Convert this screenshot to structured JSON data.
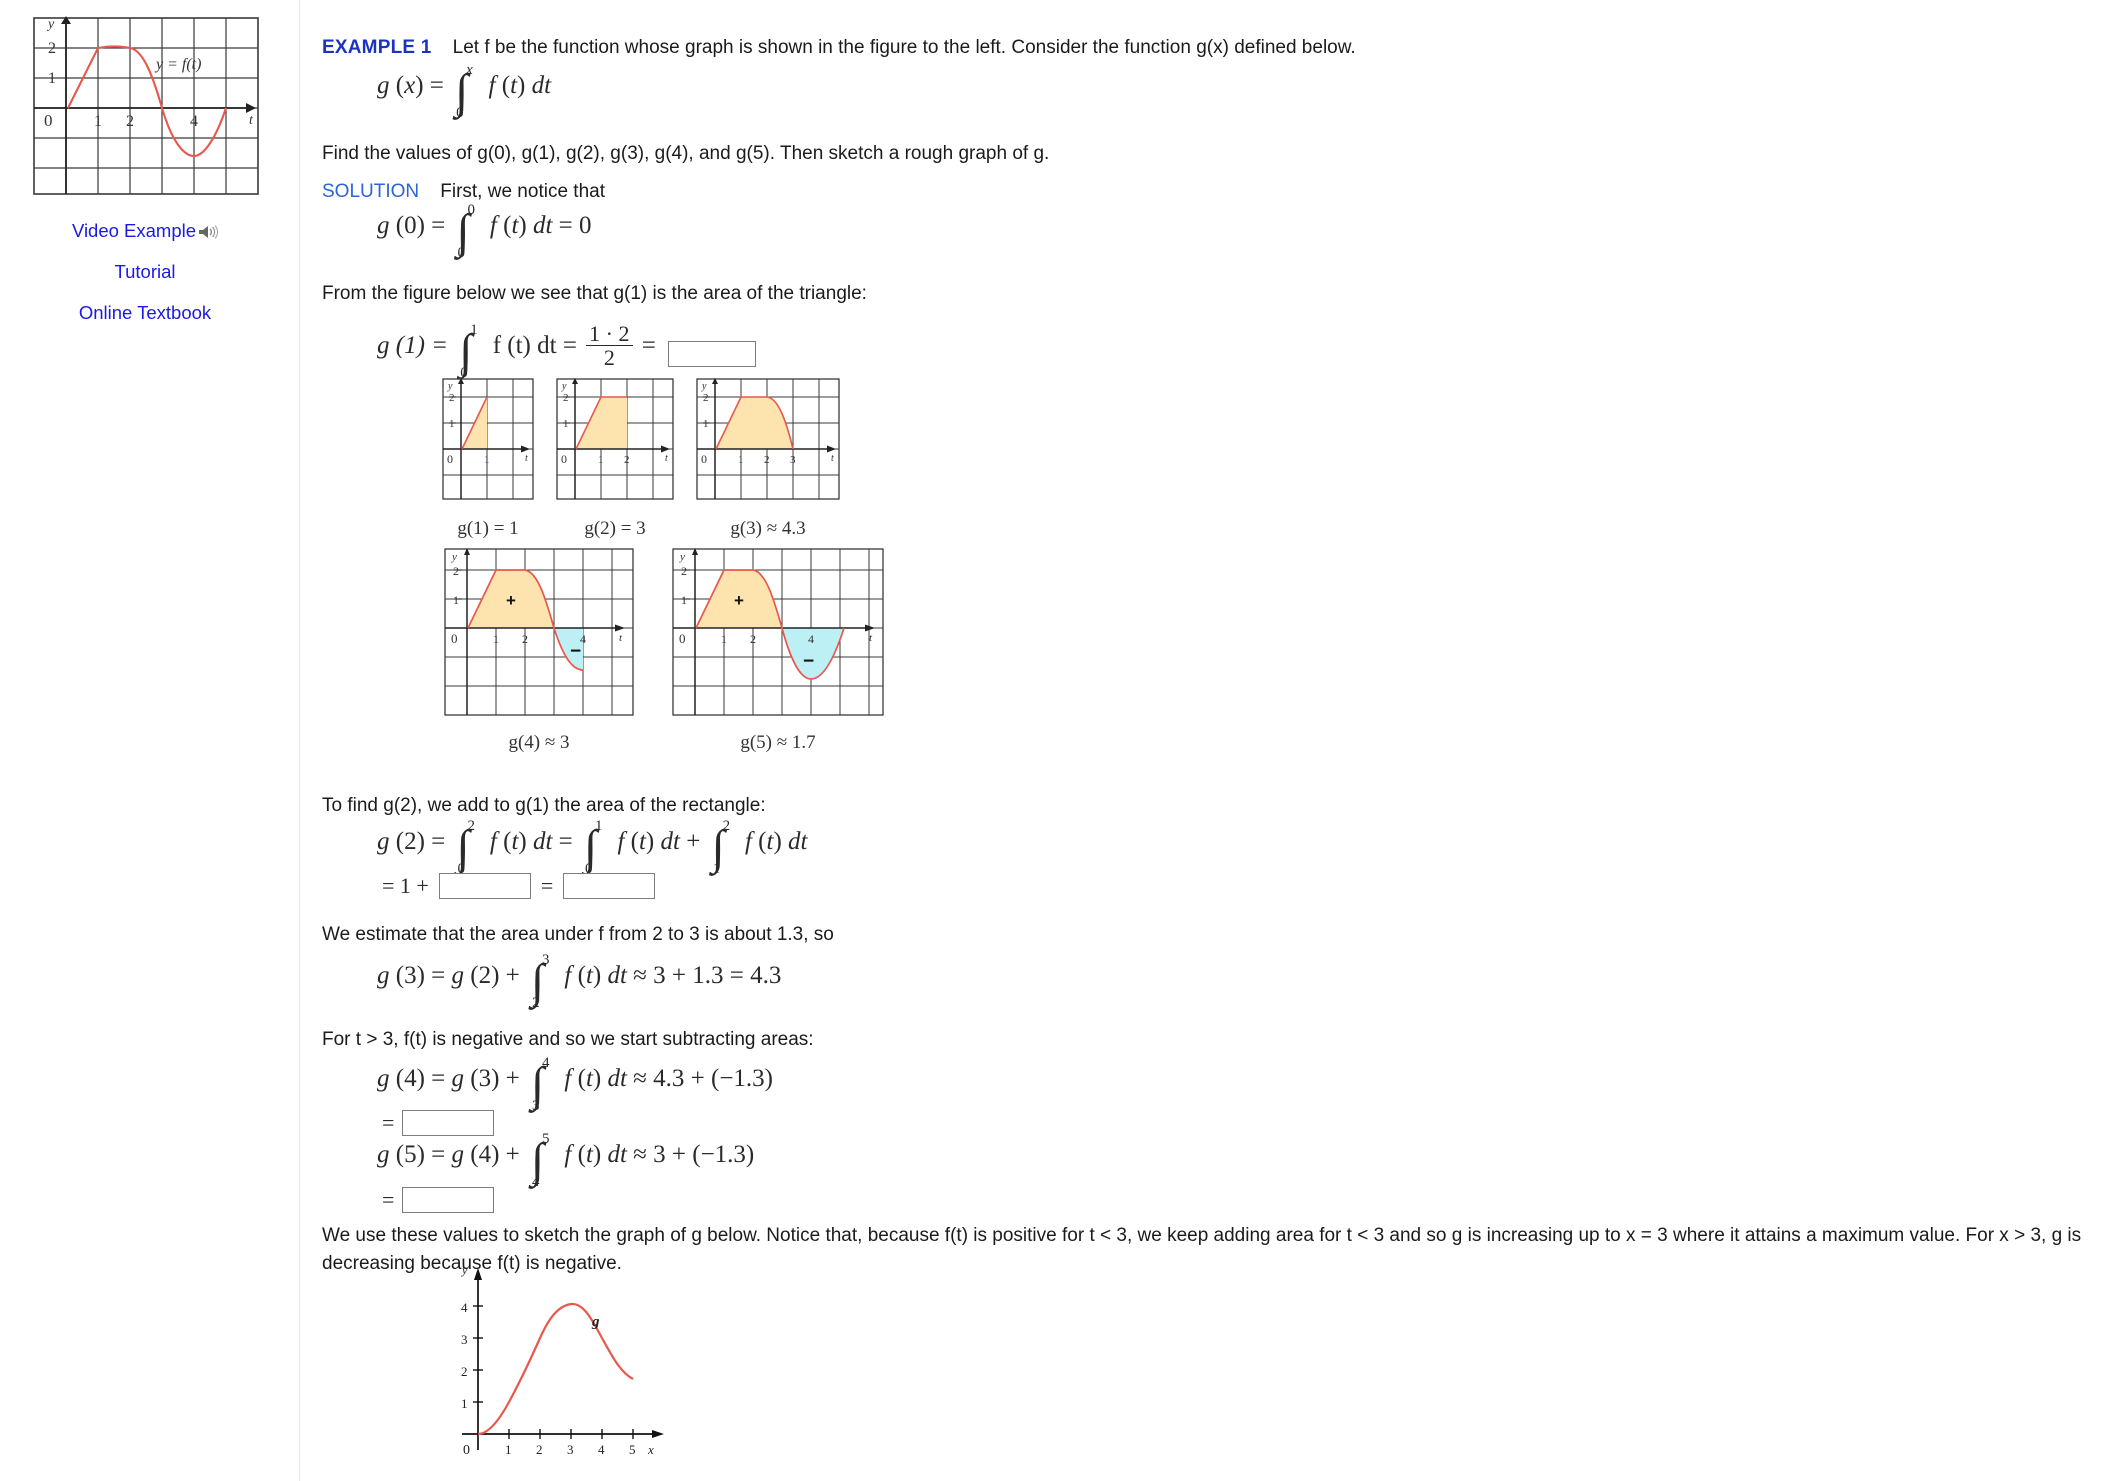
{
  "sidebar": {
    "figure": {
      "name": "graph-of-f",
      "curve_label": "y = f(t)",
      "y_axis": "y",
      "x_axis": "t",
      "y_ticks": [
        "2",
        "1"
      ],
      "x_ticks": [
        "0",
        "1",
        "2",
        "4"
      ]
    },
    "links": [
      {
        "label": "Video Example",
        "icon": "speaker-icon"
      },
      {
        "label": "Tutorial",
        "icon": null
      },
      {
        "label": "Online Textbook",
        "icon": null
      }
    ]
  },
  "main": {
    "example_label": "EXAMPLE 1",
    "intro_text": "Let f be the function whose graph is shown in the figure to the left. Consider the function g(x) defined below.",
    "eq_gx": "g (x) = ∫₀ˣ f (t) dt",
    "find_text": "Find the values of g(0), g(1), g(2), g(3), g(4), and g(5). Then sketch a rough graph of g.",
    "solution_label": "SOLUTION",
    "solution_intro": "First, we notice that",
    "eq_g0": "g (0) = ∫₀⁰ f (t) dt = 0",
    "from_figure_text": "From the figure below we see that g(1) is the area of the triangle:",
    "eq_g1_prefix": "g (1) =",
    "eq_g1_func": "f (t) dt",
    "eq_g1_frac_num": "1 · 2",
    "eq_g1_frac_den": "2",
    "g1_input_value": "",
    "find_g2_text": "To find g(2), we add to g(1) the area of the rectangle:",
    "eq_g2_line1": "g (2) = ∫₀² f (t) dt = ∫₀¹ f (t) dt + ∫₁² f (t) dt",
    "eq_g2_line2_prefix": "= 1 +",
    "eq_g2_line2_eq": "=",
    "g2_input_a_value": "",
    "g2_input_b_value": "",
    "estimate_text": "We estimate that the area under f from 2 to 3 is about 1.3, so",
    "eq_g3": "g (3) = g (2) + ∫₂³ f (t) dt ≈ 3 + 1.3 = 4.3",
    "negative_text": "For t > 3, f(t) is negative and so we start subtracting areas:",
    "eq_g4": "g (4) = g (3) + ∫₃⁴ f (t) dt ≈ 4.3 + (−1.3)",
    "eq_g4_result_prefix": "=",
    "g4_input_value": "",
    "eq_g5": "g (5) = g (4) + ∫₄⁵ f (t) dt ≈ 3 + (−1.3)",
    "eq_g5_result_prefix": "=",
    "g5_input_value": "",
    "closing_text": "We use these values to sketch the graph of g below. Notice that, because f(t) is positive for t < 3, we keep adding area for t < 3 and so g is increasing up to x = 3 where it attains a maximum value. For x > 3, g is decreasing because f(t) is negative."
  },
  "figures": {
    "row1": [
      {
        "name": "fig-g1",
        "caption": "g(1) = 1",
        "shade_to": 1,
        "x_ticks": [
          "0",
          "1"
        ],
        "y_ticks": [
          "2",
          "1"
        ]
      },
      {
        "name": "fig-g2",
        "caption": "g(2) = 3",
        "shade_to": 2,
        "x_ticks": [
          "0",
          "1",
          "2"
        ],
        "y_ticks": [
          "2",
          "1"
        ]
      },
      {
        "name": "fig-g3",
        "caption": "g(3) ≈ 4.3",
        "shade_to": 3,
        "x_ticks": [
          "0",
          "1",
          "2",
          "3"
        ],
        "y_ticks": [
          "2",
          "1"
        ]
      }
    ],
    "row2": [
      {
        "name": "fig-g4",
        "caption": "g(4) ≈ 3",
        "shade_to": 4,
        "x_ticks": [
          "0",
          "1",
          "2",
          "4"
        ],
        "y_ticks": [
          "2",
          "1"
        ],
        "plus_sign": "+",
        "minus_sign": "−"
      },
      {
        "name": "fig-g5",
        "caption": "g(5) ≈ 1.7",
        "shade_to": 5,
        "x_ticks": [
          "0",
          "1",
          "2",
          "4"
        ],
        "y_ticks": [
          "2",
          "1"
        ],
        "plus_sign": "+",
        "minus_sign": "−"
      }
    ]
  },
  "chart_data": {
    "type": "line",
    "title": "",
    "xlabel": "x",
    "ylabel": "y",
    "series_label": "g",
    "x_ticks": [
      "0",
      "1",
      "2",
      "3",
      "4",
      "5"
    ],
    "y_ticks": [
      "1",
      "2",
      "3",
      "4"
    ],
    "xlim": [
      0,
      5.6
    ],
    "ylim": [
      0,
      4.8
    ],
    "x": [
      0,
      0.5,
      1,
      1.5,
      2,
      2.5,
      3,
      3.5,
      4,
      4.5,
      5
    ],
    "y": [
      0,
      0.25,
      1.0,
      2.0,
      3.0,
      3.9,
      4.3,
      4.05,
      3.0,
      2.05,
      1.7
    ],
    "key_points": {
      "g0": 0,
      "g1": 1,
      "g2": 3,
      "g3": 4.3,
      "g4": 3,
      "g5": 1.7
    },
    "grid": false,
    "legend": "inline-curve-label"
  },
  "colors": {
    "curve": "#e8584f",
    "shade_positive": "#fde3ad",
    "shade_negative": "#bdf0f5",
    "link": "#1a1ae6",
    "heading": "#1a33c4",
    "grid": "#3a3a3a"
  }
}
